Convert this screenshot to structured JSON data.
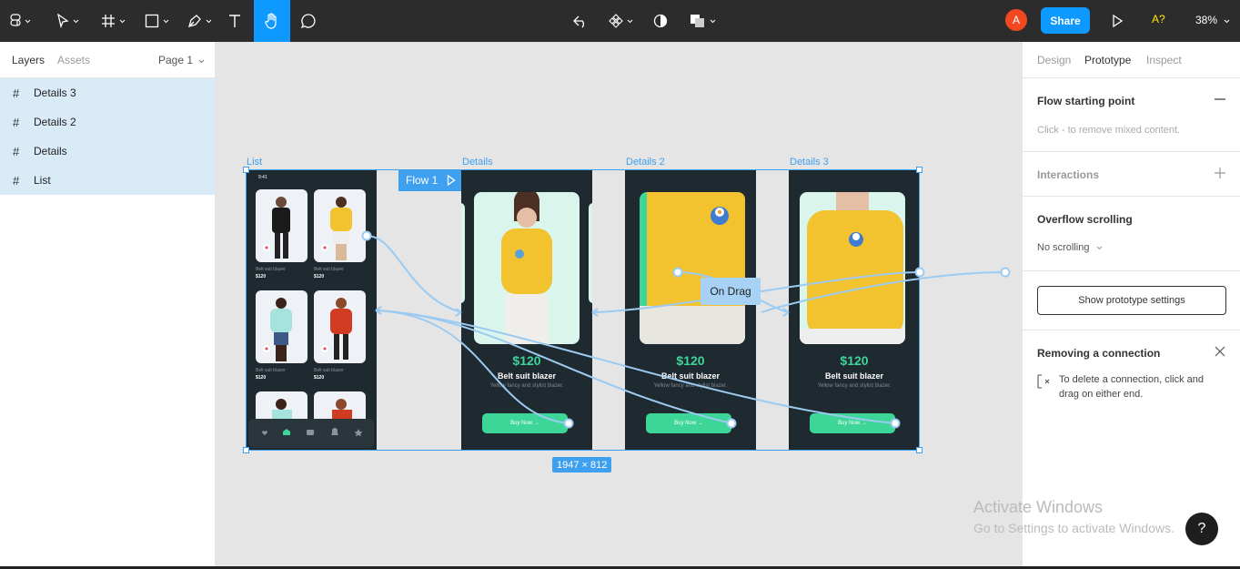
{
  "toolbar": {
    "zoom": "38%",
    "share_label": "Share",
    "avatar_initial": "A",
    "a11y_label": "A?"
  },
  "left_panel": {
    "tabs": [
      "Layers",
      "Assets"
    ],
    "page": "Page 1",
    "layers": [
      "Details 3",
      "Details 2",
      "Details",
      "List"
    ]
  },
  "right_panel": {
    "tabs": [
      "Design",
      "Prototype",
      "Inspect"
    ],
    "flow_title": "Flow starting point",
    "flow_sub": "Click - to remove mixed content.",
    "interactions": "Interactions",
    "overflow_title": "Overflow scrolling",
    "overflow_value": "No scrolling",
    "proto_settings": "Show prototype settings",
    "remove_title": "Removing a connection",
    "remove_text": "To delete a connection, click and drag on either end."
  },
  "canvas": {
    "frame_labels": [
      "List",
      "Details",
      "Details 2",
      "Details 3"
    ],
    "flow_tag": "Flow 1",
    "dimensions": "1947 × 812",
    "interaction_label": "On Drag",
    "list_frame": {
      "status_time": "9:41",
      "items": [
        {
          "caption": "Belt suit blazer",
          "price": "$120"
        },
        {
          "caption": "Belt suit blazer",
          "price": "$120"
        },
        {
          "caption": "Belt suit blazer",
          "price": "$120"
        },
        {
          "caption": "Belt suit blazer",
          "price": "$120"
        }
      ]
    },
    "detail": {
      "price": "$120",
      "name": "Belt suit blazer",
      "desc": "Yellow fancy and stylist blazer.",
      "buy": "Buy Now →"
    }
  },
  "watermark": {
    "line1": "Activate Windows",
    "line2": "Go to Settings to activate Windows."
  },
  "help_label": "?"
}
